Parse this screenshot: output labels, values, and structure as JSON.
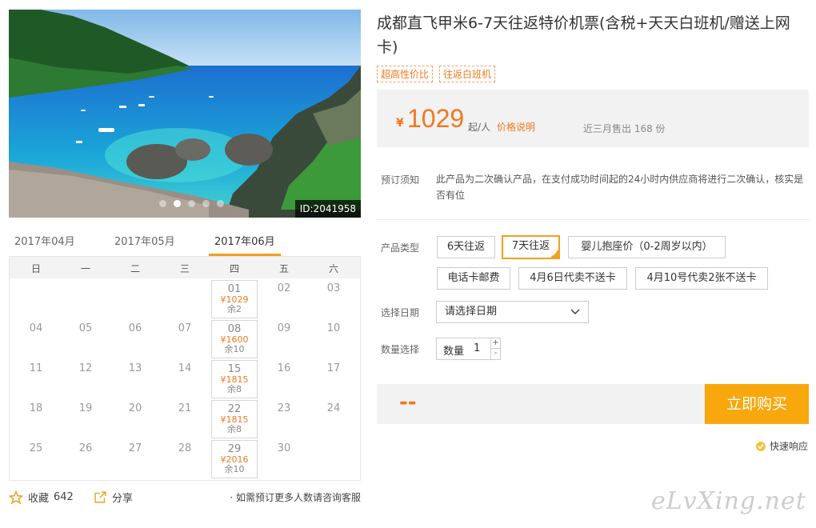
{
  "product": {
    "title": "成都直飞甲米6-7天往返特价机票(含税+天天白班机/赠送上网卡)",
    "tags": [
      "超高性价比",
      "往返白班机"
    ],
    "photo_id": "ID:2041958",
    "carousel": {
      "count": 5,
      "active": 1
    }
  },
  "price_box": {
    "currency": "¥",
    "amount": "1029",
    "unit": "起/人",
    "price_link": "价格说明",
    "sold": "近三月售出 168 份"
  },
  "notice": {
    "label": "预订须知",
    "text": "此产品为二次确认产品，在支付成功时间起的24小时内供应商将进行二次确认，核实是否有位"
  },
  "product_type": {
    "label": "产品类型",
    "options": [
      "6天往返",
      "7天往返",
      "婴儿抱座价（0-2周岁以内）",
      "电话卡邮费",
      "4月6日代卖不送卡",
      "4月10号代卖2张不送卡"
    ],
    "selected": "7天往返"
  },
  "date": {
    "label": "选择日期",
    "placeholder": "请选择日期"
  },
  "quantity": {
    "label": "数量选择",
    "field_label": "数量",
    "value": "1",
    "plus": "+",
    "minus": "-"
  },
  "buy": {
    "total": "--",
    "button": "立即购买"
  },
  "quick_response": "快速响应",
  "calendar": {
    "months": [
      "2017年04月",
      "2017年05月",
      "2017年06月"
    ],
    "active_month": "2017年06月",
    "weekdays": [
      "日",
      "一",
      "二",
      "三",
      "四",
      "五",
      "六"
    ],
    "days": [
      "01",
      "02",
      "03",
      "04",
      "05",
      "06",
      "07",
      "08",
      "09",
      "10",
      "11",
      "12",
      "13",
      "14",
      "15",
      "16",
      "17",
      "18",
      "19",
      "20",
      "21",
      "22",
      "23",
      "24",
      "25",
      "26",
      "27",
      "28",
      "29",
      "30"
    ],
    "prices": {
      "01": {
        "price": "¥1029",
        "left": "余2"
      },
      "08": {
        "price": "¥1600",
        "left": "余10"
      },
      "15": {
        "price": "¥1815",
        "left": "余8"
      },
      "22": {
        "price": "¥1815",
        "left": "余8"
      },
      "29": {
        "price": "¥2016",
        "left": "余10"
      }
    }
  },
  "social": {
    "favorite": "收藏",
    "favorite_count": "642",
    "share": "分享",
    "note": "· 如需预订更多人数请咨询客服"
  },
  "watermark": "eLvXing.net",
  "colors": {
    "accent": "#f0781e",
    "buy_button": "#f8a80c",
    "selected_border": "#f0a020"
  }
}
